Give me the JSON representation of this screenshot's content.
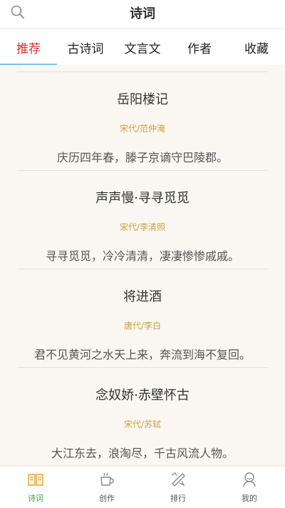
{
  "header": {
    "title": "诗词",
    "search_icon": "search-icon"
  },
  "tabs": [
    {
      "label": "推荐",
      "active": true
    },
    {
      "label": "古诗词",
      "active": false
    },
    {
      "label": "文言文",
      "active": false
    },
    {
      "label": "作者",
      "active": false
    },
    {
      "label": "收藏",
      "active": false
    }
  ],
  "poems": [
    {
      "title": "岳阳楼记",
      "author": "宋代/范仲淹",
      "line": "庆历四年春，滕子京谪守巴陵郡。"
    },
    {
      "title": "声声慢·寻寻觅觅",
      "author": "宋代/李清照",
      "line": "寻寻觅觅，冷冷清清，凄凄惨惨戚戚。"
    },
    {
      "title": "将进酒",
      "author": "唐代/李白",
      "line": "君不见黄河之水天上来，奔流到海不复回。"
    },
    {
      "title": "念奴娇·赤壁怀古",
      "author": "宋代/苏轼",
      "line": "大江东去，浪淘尽，千古风流人物。"
    }
  ],
  "bottom_nav": [
    {
      "label": "诗词",
      "icon": "book-icon",
      "active": true
    },
    {
      "label": "创作",
      "icon": "cup-icon",
      "active": false
    },
    {
      "label": "排行",
      "icon": "ranking-icon",
      "active": false
    },
    {
      "label": "我的",
      "icon": "profile-icon",
      "active": false
    }
  ],
  "colors": {
    "active_tab": "#d9302b",
    "tab_underline": "#7fc4e8",
    "author": "#c9a444",
    "active_nav": "#3ba33b",
    "content_bg": "#faf7f2"
  }
}
